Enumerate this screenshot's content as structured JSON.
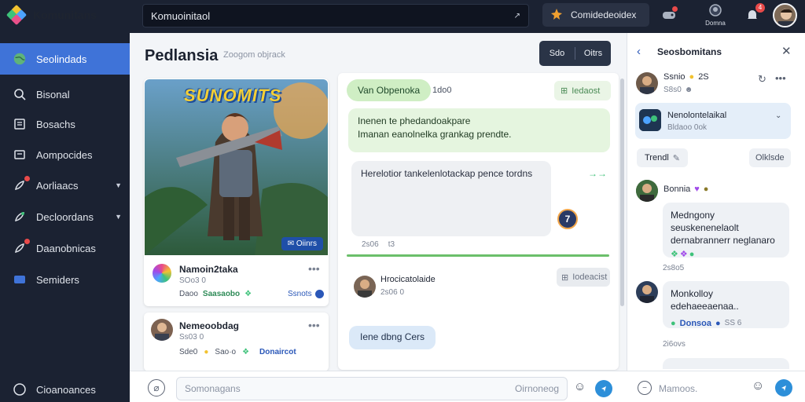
{
  "app": {
    "title": "Komunitans"
  },
  "sidebar": {
    "items": [
      {
        "label": "Seolindads",
        "icon": "globe-icon",
        "active": true
      },
      {
        "label": "Bisonal",
        "icon": "search-icon"
      },
      {
        "label": "Bosachs",
        "icon": "bookmark-icon"
      },
      {
        "label": "Aompocides",
        "icon": "inbox-icon"
      },
      {
        "label": "Aorliaacs",
        "icon": "rocket-icon",
        "badge": true,
        "expandable": true
      },
      {
        "label": "Decloordans",
        "icon": "leaf-icon",
        "expandable": true
      },
      {
        "label": "Daanobnicas",
        "icon": "rocket-icon",
        "badge": true
      },
      {
        "label": "Semiders",
        "icon": "rectangle-icon"
      }
    ],
    "footer": "Cioanoances"
  },
  "topbar": {
    "search_value": "Komuoinitaol",
    "community_button": "Comidedeoidex",
    "notif_count": "4",
    "profile_label": "Domna"
  },
  "main": {
    "title": "Pedlansia",
    "subtitle": "Zoogom objrack",
    "seg_left": "Sdo",
    "seg_right": "Oitrs"
  },
  "game_card": {
    "banner_text": "SUNOMITS",
    "tag": "✉ Oiinrs",
    "user": "Namoin2taka",
    "meta": "SOo3 0",
    "footer_left": "Daoo",
    "footer_tag": "Saasaobo",
    "footer_right": "Ssnots"
  },
  "game_card2": {
    "user": "Nemeoobdag",
    "meta": "Ss03 0",
    "footer_left": "Sde0",
    "footer_mid": "Sao·o",
    "footer_link": "Donaircot"
  },
  "feed": {
    "pill": "Van Obpenoka",
    "pill_count": "1do0",
    "top_right_chip": "Iedaost",
    "green_bubble_line1": "Inenen te phedandoakpare",
    "green_bubble_line2": "Imanan eanolnelka grankag prendte.",
    "gray_bubble": "Herelotior tankelenlotackap pence tordns",
    "gray_meta": "2s06",
    "gray_meta2": "t3",
    "share_arrows": "→→",
    "post2_user": "Hrocicatolaide",
    "post2_meta": "2s06 0",
    "post2_chip": "Iodeacist",
    "post2_bubble": "Iene dbng Cers"
  },
  "composer": {
    "placeholder": "Somonagans",
    "right_hint": "Oirnoneog"
  },
  "right_panel": {
    "title": "Seosbomitans",
    "user1": "Ssnio",
    "user1_badge": "2S",
    "user1_meta": "S8s0",
    "group_name": "Nenolontelaikal",
    "group_meta": "Bldaoo 0ok",
    "trend_chip": "Trendl",
    "right_chip": "Olklsde",
    "user2": "Bonnia",
    "msg2_line1": "Medngony seuskenenelaolt",
    "msg2_line2": "dernabrannerr neglanaro",
    "ts1": "2s8o5",
    "msg3": "Monkolloy edehaeeaenaa..",
    "msg3_tag": "Donsoa",
    "msg3_meta": "SS 6",
    "ts2": "2i6ovs",
    "input_placeholder": "Mamoos."
  },
  "colors": {
    "accent": "#3f73d8",
    "sidebar": "#1b2232",
    "green_bubble": "#e5f5df",
    "send": "#2d8fd9"
  }
}
